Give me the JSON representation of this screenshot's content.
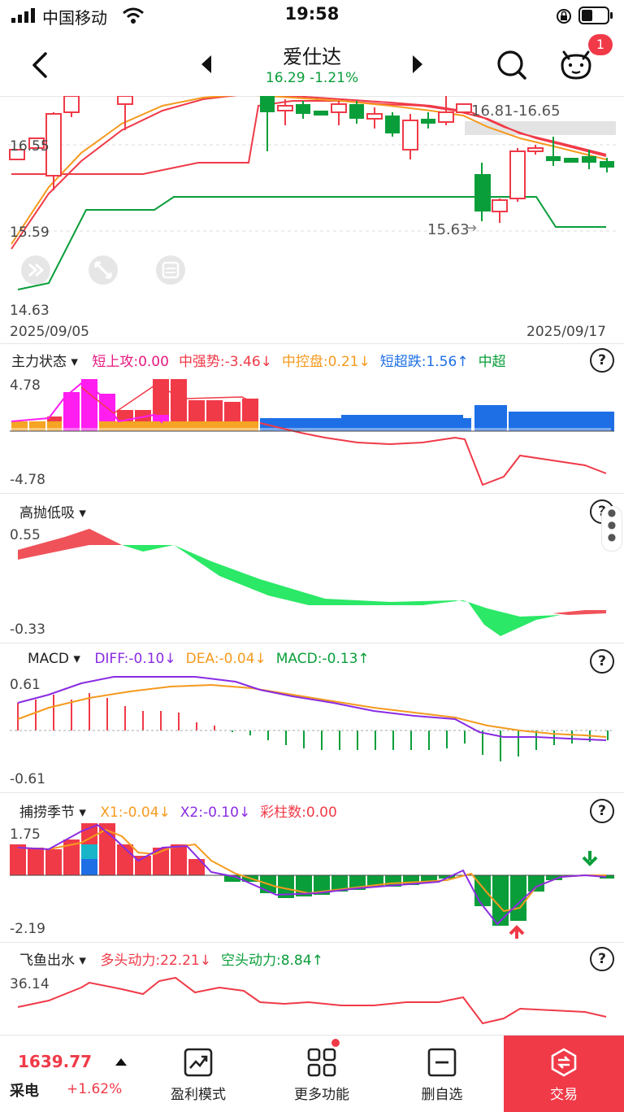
{
  "status_bar": {
    "carrier": "中国移动",
    "time": "19:58"
  },
  "nav": {
    "title": "爱仕达",
    "price": "16.29",
    "change": "-1.21%",
    "notification_count": "1"
  },
  "main_chart": {
    "price_labels": {
      "top": "16.55",
      "mid": "15.59",
      "low": "14.63"
    },
    "annotation_high": "16.81-16.65",
    "annotation_low": "15.63",
    "date_start": "2025/09/05",
    "date_end": "2025/09/17"
  },
  "panel_main_force": {
    "selector": "主力状态",
    "items": [
      {
        "text": "短上攻:0.00",
        "color": "#e6177e"
      },
      {
        "text": "中强势:-3.46↓",
        "color": "#f03a48"
      },
      {
        "text": "中控盘:0.21↓",
        "color": "#f59a1e"
      },
      {
        "text": "短超跌:1.56↑",
        "color": "#1e6fe6"
      },
      {
        "text": "中超",
        "color": "#0a9e3a"
      }
    ],
    "max": "4.78",
    "min": "-4.78"
  },
  "panel_high_low": {
    "selector": "高抛低吸",
    "max": "0.55",
    "min": "-0.33"
  },
  "panel_macd": {
    "selector": "MACD",
    "items": [
      {
        "text": "DIFF:-0.10↓",
        "color": "#8a2be2"
      },
      {
        "text": "DEA:-0.04↓",
        "color": "#f59a1e"
      },
      {
        "text": "MACD:-0.13↑",
        "color": "#0a9e3a"
      }
    ],
    "max": "0.61",
    "min": "-0.61"
  },
  "panel_fishing": {
    "selector": "捕捞季节",
    "items": [
      {
        "text": "X1:-0.04↓",
        "color": "#f59a1e"
      },
      {
        "text": "X2:-0.10↓",
        "color": "#8a2be2"
      },
      {
        "text": "彩柱数:0.00",
        "color": "#f03a48"
      }
    ],
    "max": "1.75",
    "min": "-2.19"
  },
  "panel_flying_fish": {
    "selector": "飞鱼出水",
    "items": [
      {
        "text": "多头动力:22.21↓",
        "color": "#f03a48"
      },
      {
        "text": "空头动力:8.84↑",
        "color": "#0a9e3a"
      }
    ],
    "max": "36.14"
  },
  "bottom_bar": {
    "index_value": "1639.77",
    "index_name_fragment": "采电",
    "index_change": "+1.62%",
    "tabs": [
      "盈利模式",
      "更多功能",
      "删自选"
    ],
    "trade": "交易"
  },
  "colors": {
    "up": "#f03a48",
    "down": "#0a9e3a",
    "accent": "#f03a48"
  }
}
